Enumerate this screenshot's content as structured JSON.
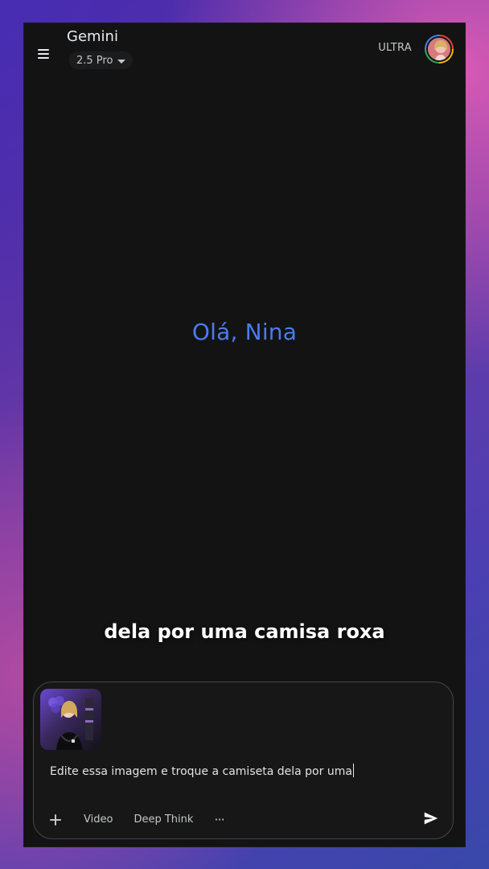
{
  "header": {
    "title": "Gemini",
    "model": "2.5 Pro",
    "plan": "ULTRA",
    "menu_icon": "menu-icon",
    "model_icon": "chevron-down-icon",
    "avatar_icon": "profile-avatar"
  },
  "main": {
    "greeting": "Olá, Nina",
    "caption": "dela por uma camisa roxa"
  },
  "composer": {
    "attachment_label": "attached-image",
    "input_text": "Edite essa imagem e troque a camiseta dela por uma",
    "toolbar": {
      "plus_icon": "plus-icon",
      "video_label": "Video",
      "deep_think_label": "Deep Think",
      "more_label": "···"
    },
    "send_icon": "send-icon"
  },
  "colors": {
    "background": "#131314",
    "greeting": "#4b7bf0",
    "text_primary": "#e8eaed",
    "text_secondary": "#c4c7c5",
    "border": "#444746"
  }
}
